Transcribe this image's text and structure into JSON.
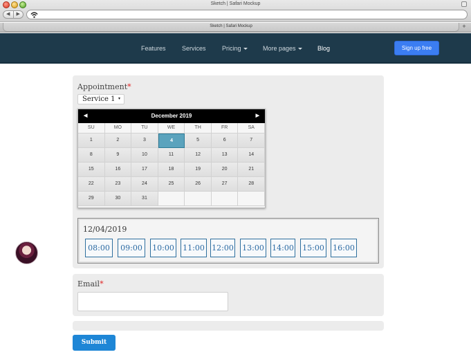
{
  "browser": {
    "window_title": "Sketch | Safari Mockup",
    "tab_title": "Sketch | Safari Mockup",
    "back_glyph": "◀",
    "forward_glyph": "▶",
    "new_tab_glyph": "+"
  },
  "navbar": {
    "links": [
      {
        "label": "Features"
      },
      {
        "label": "Services"
      },
      {
        "label": "Pricing",
        "dropdown": true
      },
      {
        "label": "More pages",
        "dropdown": true
      },
      {
        "label": "Blog",
        "active": true
      }
    ],
    "cta_label": "Sign up free",
    "background": "#1e3a4b",
    "cta_color": "#3b7df2"
  },
  "form": {
    "appointment_label": "Appointment",
    "required_mark": "*",
    "service_value": "Service 1",
    "service_dropdown_glyph": "▾",
    "calendar": {
      "month_label": "December 2019",
      "prev_glyph": "◀",
      "next_glyph": "▶",
      "weekdays": [
        "SU",
        "MO",
        "TU",
        "WE",
        "TH",
        "FR",
        "SA"
      ],
      "weeks": [
        [
          "1",
          "2",
          "3",
          "4",
          "5",
          "6",
          "7"
        ],
        [
          "8",
          "9",
          "10",
          "11",
          "12",
          "13",
          "14"
        ],
        [
          "15",
          "16",
          "17",
          "18",
          "19",
          "20",
          "21"
        ],
        [
          "22",
          "23",
          "24",
          "25",
          "26",
          "27",
          "28"
        ],
        [
          "29",
          "30",
          "31",
          "",
          "",
          "",
          ""
        ]
      ],
      "selected_day": "4",
      "selected_color": "#5ba3bd"
    },
    "selected_date": "12/04/2019",
    "time_slots": [
      "08:00",
      "09:00",
      "10:00",
      "11:00",
      "12:00",
      "13:00",
      "14:00",
      "15:00",
      "16:00"
    ],
    "email_label": "Email",
    "email_value": "",
    "submit_label": "Submit",
    "submit_color": "#1e86d6"
  }
}
